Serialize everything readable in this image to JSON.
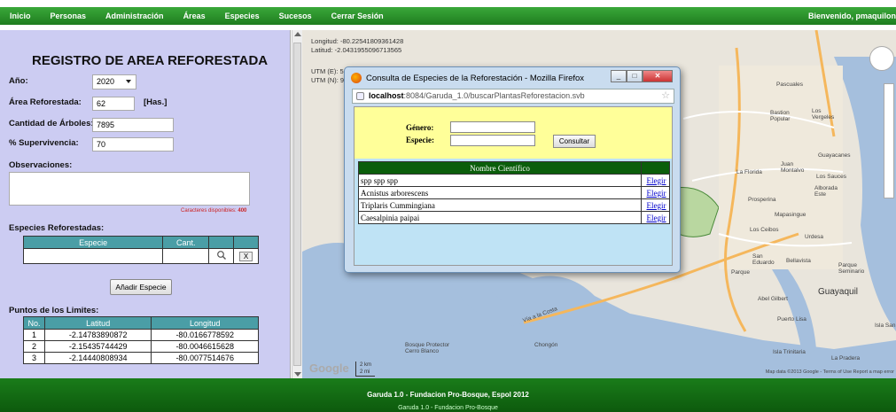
{
  "nav": {
    "items": [
      "Inicio",
      "Personas",
      "Administración",
      "Áreas",
      "Especies",
      "Sucesos",
      "Cerrar Sesión"
    ],
    "welcome": "Bienvenido, pmaquilon"
  },
  "form": {
    "title": "REGISTRO DE AREA REFORESTADA",
    "year_label": "Año:",
    "year_value": "2020",
    "area_label": "Área Reforestada:",
    "area_value": "62",
    "area_unit": "[Has.]",
    "trees_label": "Cantidad de Árboles:",
    "trees_value": "7895",
    "survival_label": "% Supervivencia:",
    "survival_value": "70",
    "observations_label": "Observaciones:",
    "chars_label": "Caracteres disponibles:",
    "chars_value": "400",
    "species_label": "Especies Reforestadas:",
    "species_headers": [
      "Especie",
      "Cant."
    ],
    "remove_label": "X",
    "add_species_button": "Añadir Especie",
    "points_label": "Puntos de los Limites:",
    "points_headers": [
      "No.",
      "Latitud",
      "Longitud"
    ],
    "points": [
      {
        "no": "1",
        "lat": "-2.14783890872",
        "lon": "-80.0166778592"
      },
      {
        "no": "2",
        "lat": "-2.15435744429",
        "lon": "-80.0046615628"
      },
      {
        "no": "3",
        "lat": "-2.14440808934",
        "lon": "-80.0077514676"
      }
    ]
  },
  "map": {
    "longitude": "Longitud: -80.22541809361428",
    "latitude": "Latitud: -2.0431955096713565",
    "utm_e": "UTM (E): 5",
    "utm_n": "UTM (N): 9",
    "labels": {
      "pascuales": "Pascuales",
      "bastion": "Bastion Popular",
      "los_vergeles": "Los Vergeles",
      "guayacanes": "Guayacanes",
      "juan_montalvo": "Juan Montalvo",
      "la_florida": "La Florida",
      "los_sauces": "Los Sauces",
      "alborada": "Alborada Este",
      "prosperina": "Prosperina",
      "mapasingue": "Mapasingue",
      "los_ceibos": "Los Ceibos",
      "urdesa": "Urdesa",
      "san_eduardo": "San Eduardo",
      "bellavista": "Bellavista",
      "parque_seminario": "Parque Seminario",
      "guayaquil": "Guayaquil",
      "abel_gilbert": "Abel Gilbert",
      "puerto_lisa": "Puerto Lisa",
      "isla_santay": "Isla San",
      "isla_trinitaria": "Isla Trinitaria",
      "la_pradera": "La Pradera",
      "bosque": "Bosque Protector Cerro Blanco",
      "chongon": "Chongón",
      "via_costa": "Vía a la Costa",
      "parque": "Parque"
    },
    "scale_km": "2 km",
    "scale_mi": "2 mi",
    "google": "Google",
    "copyright": "Map data ©2013 Google - Terms of Use  Report a map error"
  },
  "footer": {
    "text": "Garuda 1.0 - Fundacion Pro-Bosque, Espol 2012",
    "subtext": "Garuda 1.0 - Fundacion Pro-Bosque"
  },
  "popup": {
    "title": "Consulta de Especies de la Reforestación - Mozilla Firefox",
    "url_host": "localhost",
    "url_rest": ":8084/Garuda_1.0/buscarPlantasReforestacion.svb",
    "genero_label": "Género:",
    "especie_label": "Especie:",
    "consult_button": "Consultar",
    "table_header": "Nombre Científico",
    "choose_label": "Elegir",
    "rows": [
      "spp spp spp",
      "Acnistus arborescens",
      "Triplaris Cummingiana",
      "Caesalpinia paipai"
    ]
  },
  "colors": {
    "nav_green": "#1f7d1f",
    "panel_lavender": "#ccccf2",
    "table_header_teal": "#4a9ea6",
    "popup_search_yellow": "#ffff99",
    "popup_table_header": "#0b5e0b"
  }
}
